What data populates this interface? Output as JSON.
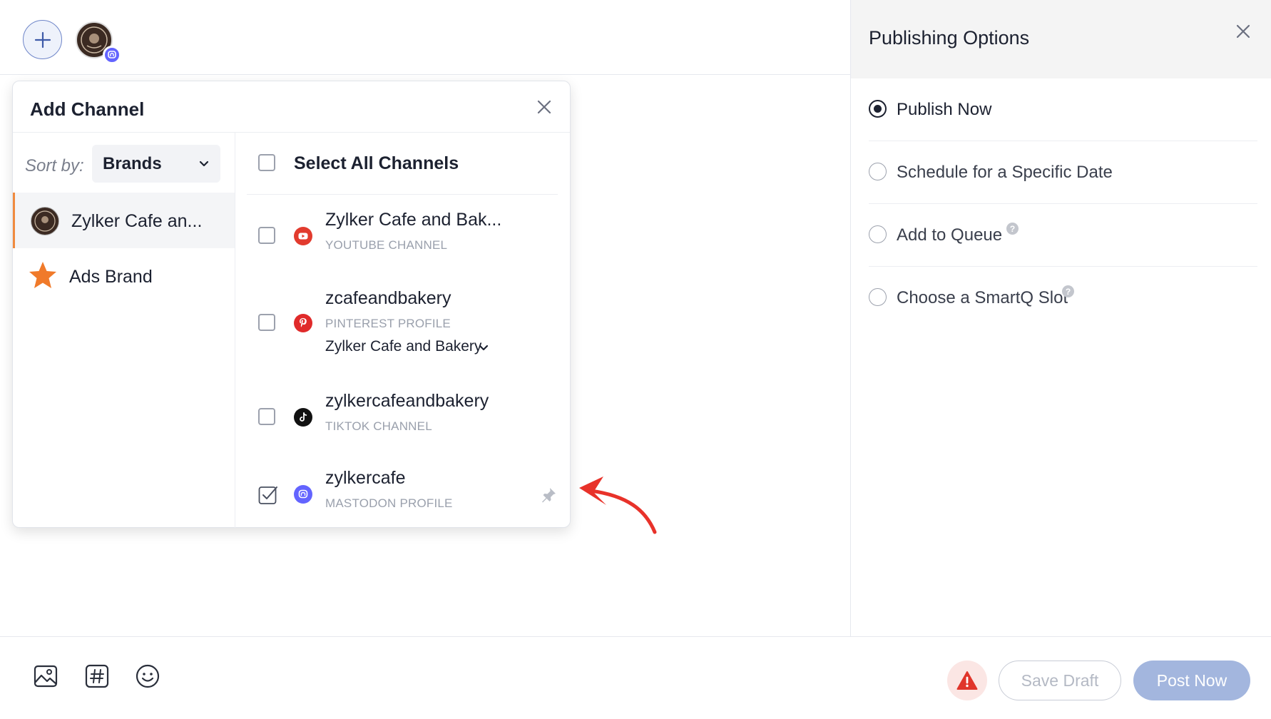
{
  "composer": {
    "add_icon": "plus-icon",
    "selected_avatar_badge_icon": "mastodon-icon"
  },
  "add_channel": {
    "title": "Add Channel",
    "sort_label": "Sort by:",
    "sort_value": "Brands",
    "brands": [
      {
        "label": "Zylker Cafe an...",
        "active": true
      },
      {
        "label": "Ads Brand",
        "active": false
      }
    ],
    "select_all_label": "Select All Channels",
    "channels": [
      {
        "name": "Zylker Cafe and Bak...",
        "type": "YOUTUBE CHANNEL",
        "icon": "youtube-icon",
        "color": "#e23b2e",
        "checked": false
      },
      {
        "name": "zcafeandbakery",
        "type": "PINTEREST PROFILE",
        "board": "Zylker Cafe and Bakery",
        "icon": "pinterest-icon",
        "color": "#e02a2a",
        "checked": false
      },
      {
        "name": "zylkercafeandbakery",
        "type": "TIKTOK CHANNEL",
        "icon": "tiktok-icon",
        "color": "#111111",
        "checked": false
      },
      {
        "name": "zylkercafe",
        "type": "MASTODON PROFILE",
        "icon": "mastodon-icon",
        "color": "#6364ff",
        "checked": true
      }
    ]
  },
  "publishing": {
    "title": "Publishing Options",
    "options": [
      {
        "label": "Publish Now",
        "selected": true
      },
      {
        "label": "Schedule for a Specific Date",
        "selected": false
      },
      {
        "label": "Add to Queue",
        "selected": false,
        "help": true
      },
      {
        "label": "Choose a SmartQ Slot",
        "selected": false,
        "help": true
      }
    ],
    "help_glyph": "?"
  },
  "footer": {
    "save_draft": "Save Draft",
    "post_now": "Post Now"
  },
  "colors": {
    "accent": "#f08a3e",
    "post_button": "#a3b6de",
    "annotation_arrow": "#e8322a"
  }
}
